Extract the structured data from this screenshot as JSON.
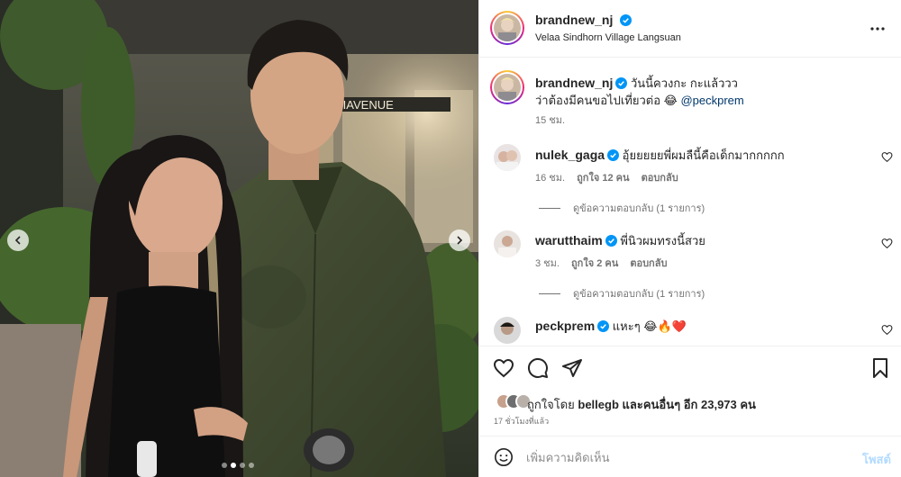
{
  "post": {
    "author": "brandnew_nj",
    "location": "Velaa Sindhorn Village Langsuan",
    "carousel": {
      "total_slides": 4,
      "active_slide": 2
    },
    "photo": {
      "store_sign": "SIAVENUE"
    }
  },
  "caption": {
    "username": "brandnew_nj",
    "text_line1": "วันนี้ควงกะ กะแล้ววว",
    "text_line2": "ว่าต้องมีคนขอไปเที่ยวต่อ 😂 ",
    "mention": "@peckprem",
    "time": "15 ชม."
  },
  "comments": [
    {
      "username": "nulek_gaga",
      "text": "อุ้ยยยยยพี่ผมลืนี้คือเด็กมากกกกก",
      "time": "16 ชม.",
      "likes": "ถูกใจ 12 คน",
      "reply_label": "ตอบกลับ",
      "view_replies": "ดูข้อความตอบกลับ (1 รายการ)"
    },
    {
      "username": "warutthaim",
      "text": "พี่นิวผมทรงนี้สวย",
      "time": "3 ชม.",
      "likes": "ถูกใจ 2 คน",
      "reply_label": "ตอบกลับ",
      "view_replies": "ดูข้อความตอบกลับ (1 รายการ)"
    },
    {
      "username": "peckprem",
      "text": "แหะๆ 😂🔥❤️"
    }
  ],
  "engagement": {
    "likes_prefix": "ถูกใจโดย ",
    "liked_by": "bellegb",
    "likes_suffix": " และคนอื่นๆ อีก 23,973 คน",
    "time_ago": "17 ชั่วโมงที่แล้ว"
  },
  "composer": {
    "placeholder": "เพิ่มความคิดเห็น",
    "post_label": "โพสต์"
  },
  "colors": {
    "verified": "#0095f6",
    "mention": "#00376b",
    "post_button_disabled": "#b3dbff"
  },
  "icons": [
    "verified-icon",
    "more-options-icon",
    "heart-icon",
    "comment-icon",
    "share-icon",
    "bookmark-icon",
    "emoji-icon",
    "chevron-left-icon",
    "chevron-right-icon"
  ]
}
